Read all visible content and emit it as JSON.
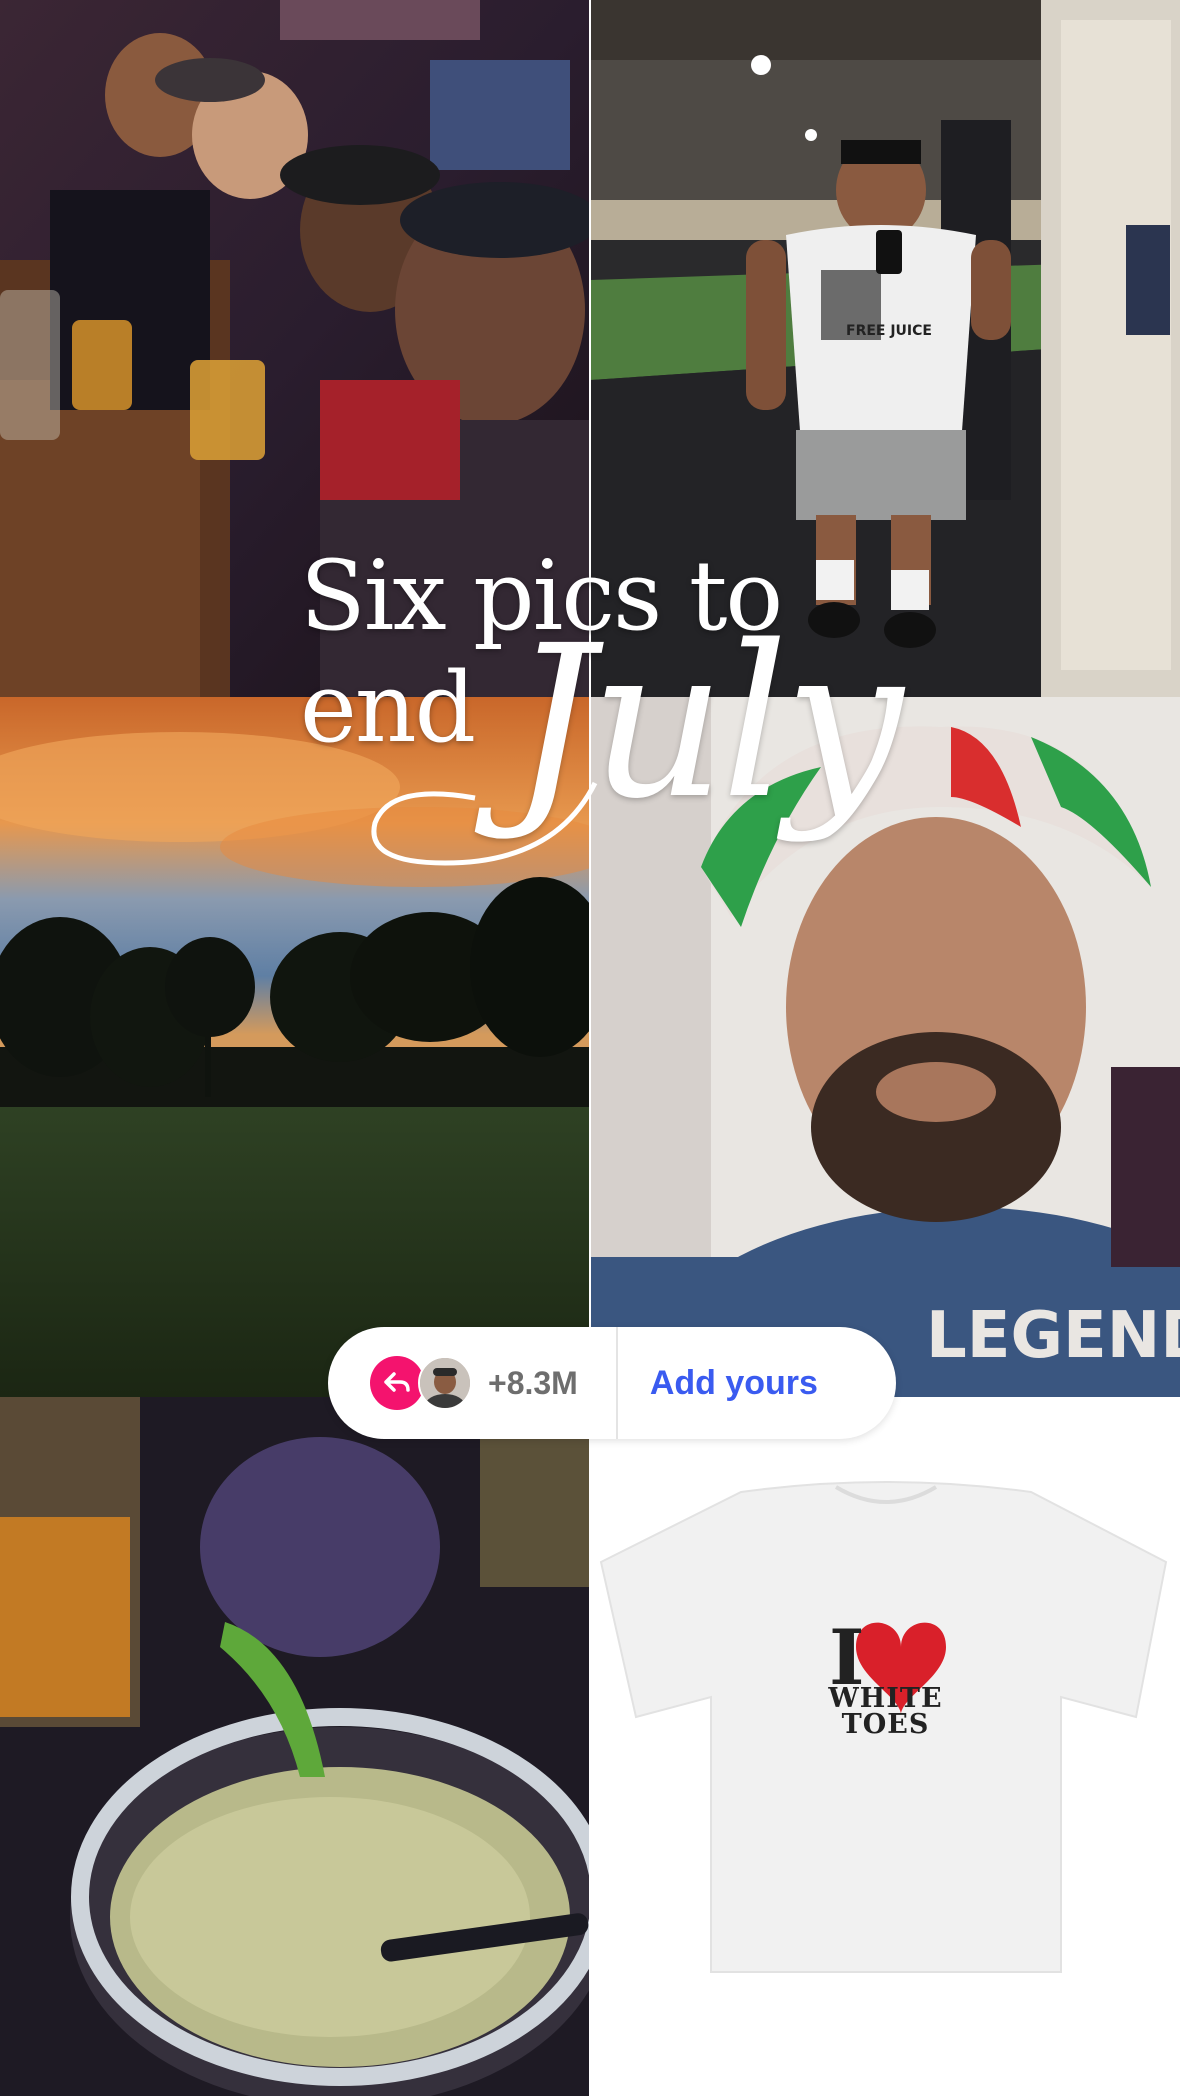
{
  "title": {
    "line1": "Six pics to",
    "line2": "end",
    "script": "July"
  },
  "add_yours": {
    "count": "+8.3M",
    "action_label": "Add yours",
    "reply_icon": "reply-arrow-icon",
    "avatar_icon": "user-avatar"
  },
  "tiles": {
    "gym_shirt_text": "FREE JUICE",
    "wig_shirt_text": "LEGEND",
    "tshirt": {
      "i": "I",
      "line1": "WHITE",
      "line2": "TOES"
    }
  },
  "colors": {
    "accent_pink": "#f4136e",
    "action_blue": "#3a5bf0",
    "heart_red": "#d9202a"
  }
}
